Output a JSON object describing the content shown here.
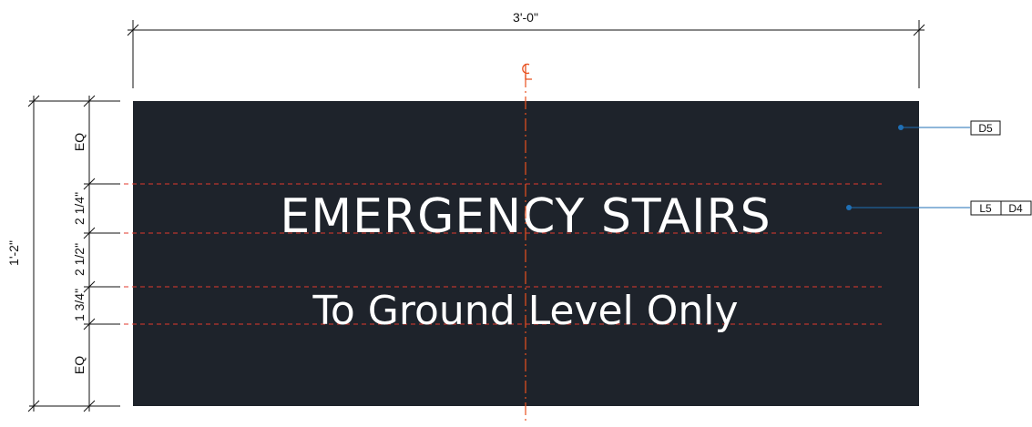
{
  "colors": {
    "sign_background": "#1e232b",
    "sign_text": "#ffffff",
    "guide_line": "#e03a2e",
    "centerline": "#e8501e",
    "leader": "#1f6fb5",
    "dimension": "#111111"
  },
  "dimensions": {
    "overall_width": "3'-0\"",
    "overall_height": "1'-2\"",
    "segment_top": "EQ",
    "segment_title": "2 1/4\"",
    "segment_gap": "2 1/2\"",
    "segment_subtitle": "1 3/4\"",
    "segment_bottom": "EQ"
  },
  "centerline": {
    "label": "CL"
  },
  "sign": {
    "title": "EMERGENCY STAIRS",
    "subtitle": "To Ground Level Only"
  },
  "callouts": {
    "background_tag": "D5",
    "text_tag_1": "L5",
    "text_tag_2": "D4"
  }
}
